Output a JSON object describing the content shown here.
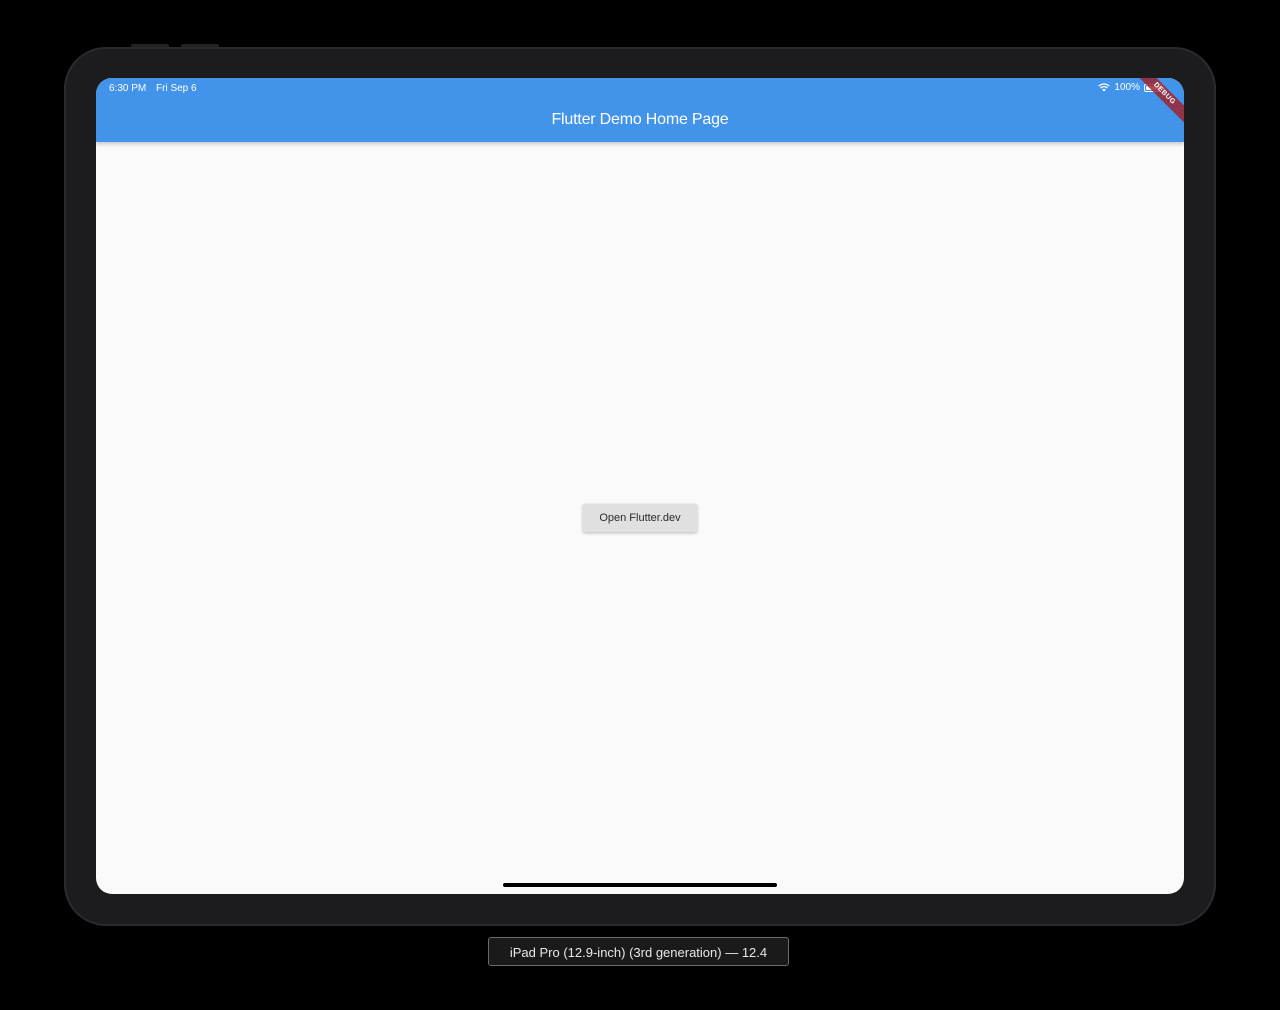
{
  "status_bar": {
    "time": "6:30 PM",
    "date": "Fri Sep 6",
    "battery": "100%",
    "wifi_icon": "wifi-icon",
    "battery_icon": "battery-icon"
  },
  "app_bar": {
    "title": "Flutter Demo Home Page",
    "color": "#4294ea"
  },
  "debug_banner": {
    "label": "DEBUG"
  },
  "main": {
    "open_button_label": "Open Flutter.dev"
  },
  "simulator": {
    "device_label": "iPad Pro (12.9-inch) (3rd generation) — 12.4"
  }
}
